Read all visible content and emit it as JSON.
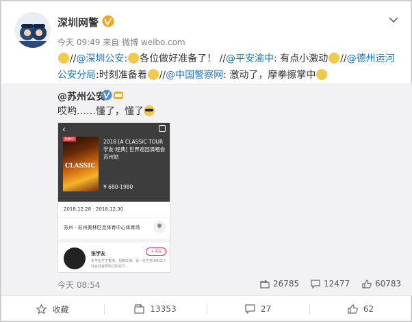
{
  "post": {
    "username": "深圳网警",
    "time": "今天 09:49",
    "source_prefix": "来自",
    "source": "微博 weibo.com",
    "body": {
      "seg1": "//",
      "mention1": "@深圳公安",
      "seg2": ":",
      "seg3": "各位做好准备了！ //",
      "mention2": "@平安渝中",
      "seg4": ": 有点小激动",
      "seg5": "//",
      "mention3": "@德州运河公安分局",
      "seg6": ":时刻准备着",
      "seg7": "//",
      "mention4": "@中国警察网",
      "seg8": ": 激动了，摩拳擦掌中"
    }
  },
  "retweet": {
    "username": "@苏州公安",
    "text": "哎哟……懂了，懂了",
    "card": {
      "back": "‹",
      "tag": "热卖中",
      "poster_text": "CLASSIC",
      "title": "2018 [A CLASSIC TOUR 学友·经典] 世界巡回演唱会 苏州站",
      "price": "¥ 680-1980",
      "date": "2018.12.28 - 2018.12.30",
      "venue": "苏州 · 苏州奥林匹克体育中心体育场",
      "artist": "张学友",
      "follow": "+ 关注",
      "bio": "张学友生于香港，祖籍天津。是一位在亚洲和华人社会具有影响力的实力..."
    },
    "time": "今天 08:54",
    "reposts": "26785",
    "comments": "12477",
    "likes": "60783"
  },
  "actions": {
    "favorite": "收藏",
    "repost": "13353",
    "comment": "27",
    "like": "62"
  },
  "colors": {
    "link": "#eb7350",
    "verified": "#f7a21c",
    "retweet_bg": "#f2f2f5"
  }
}
